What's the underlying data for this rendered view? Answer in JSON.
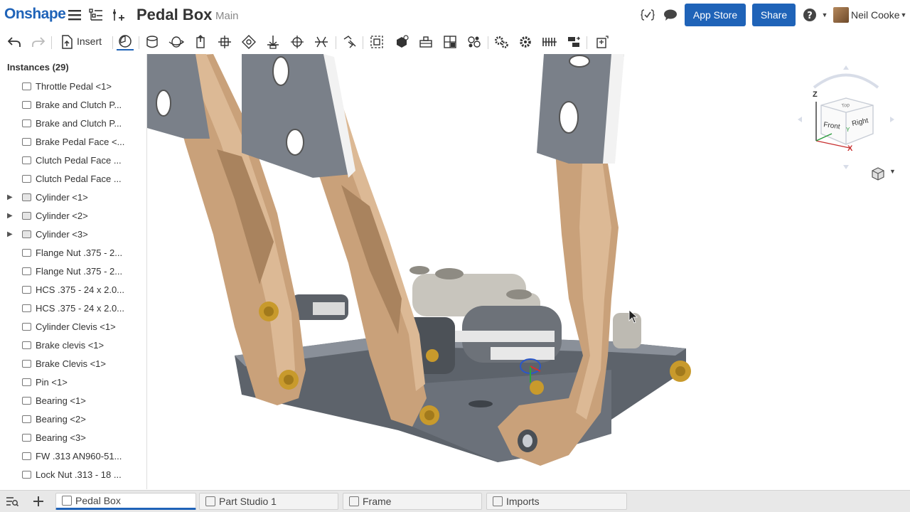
{
  "header": {
    "logo": "Onshape",
    "title": "Pedal Box",
    "branch": "Main",
    "app_store_label": "App Store",
    "share_label": "Share",
    "user_name": "Neil Cooke",
    "icons": [
      "menu-icon",
      "feature-list-icon",
      "add-feature-icon",
      "variable-icon",
      "comment-icon",
      "help-icon"
    ]
  },
  "toolbar": {
    "insert_label": "Insert",
    "icons": [
      "undo-icon",
      "redo-icon",
      "insert-icon",
      "mate-connector-icon",
      "cylinder-mate-icon",
      "revolute-mate-icon",
      "slider-mate-icon",
      "fastened-mate-icon",
      "planar-mate-icon",
      "pin-slot-mate-icon",
      "ball-mate-icon",
      "parallel-mate-icon",
      "replicate-icon",
      "group-icon",
      "linear-pattern-icon",
      "circular-pattern-icon",
      "explode-icon",
      "mate-icon",
      "gear-relation-icon",
      "rack-pinion-icon",
      "screw-relation-icon",
      "linear-relation-icon",
      "configuration-icon"
    ]
  },
  "panel": {
    "title": "Instances (29)",
    "items": [
      {
        "label": "Throttle Pedal <1>",
        "expandable": false
      },
      {
        "label": "Brake and Clutch P...",
        "expandable": false
      },
      {
        "label": "Brake and Clutch P...",
        "expandable": false
      },
      {
        "label": "Brake Pedal Face <...",
        "expandable": false
      },
      {
        "label": "Clutch Pedal Face ...",
        "expandable": false
      },
      {
        "label": "Clutch Pedal Face ...",
        "expandable": false
      },
      {
        "label": "Cylinder <1>",
        "expandable": true
      },
      {
        "label": "Cylinder <2>",
        "expandable": true
      },
      {
        "label": "Cylinder <3>",
        "expandable": true
      },
      {
        "label": "Flange Nut .375 - 2...",
        "expandable": false
      },
      {
        "label": "Flange Nut .375 - 2...",
        "expandable": false
      },
      {
        "label": "HCS .375 - 24 x 2.0...",
        "expandable": false
      },
      {
        "label": "HCS .375 - 24 x 2.0...",
        "expandable": false
      },
      {
        "label": "Cylinder Clevis <1>",
        "expandable": false
      },
      {
        "label": "Brake clevis <1>",
        "expandable": false
      },
      {
        "label": "Brake Clevis <1>",
        "expandable": false
      },
      {
        "label": "Pin <1>",
        "expandable": false
      },
      {
        "label": "Bearing <1>",
        "expandable": false
      },
      {
        "label": "Bearing <2>",
        "expandable": false
      },
      {
        "label": "Bearing <3>",
        "expandable": false
      },
      {
        "label": "FW .313 AN960-51...",
        "expandable": false
      },
      {
        "label": "Lock Nut .313 - 18 ..."
      }
    ]
  },
  "view_cube": {
    "axis_z": "Z",
    "axis_x": "X",
    "axis_y": "Y",
    "face_front": "Front",
    "face_right": "Right",
    "face_top": "Top"
  },
  "tabs": [
    {
      "label": "Pedal Box",
      "active": true
    },
    {
      "label": "Part Studio 1",
      "active": false
    },
    {
      "label": "Frame",
      "active": false
    },
    {
      "label": "Imports",
      "active": false
    }
  ],
  "colors": {
    "brand": "#1f63b8",
    "pedal_tan": "#d9b58f",
    "steel_gray": "#70757d",
    "brass": "#c89a2c"
  }
}
